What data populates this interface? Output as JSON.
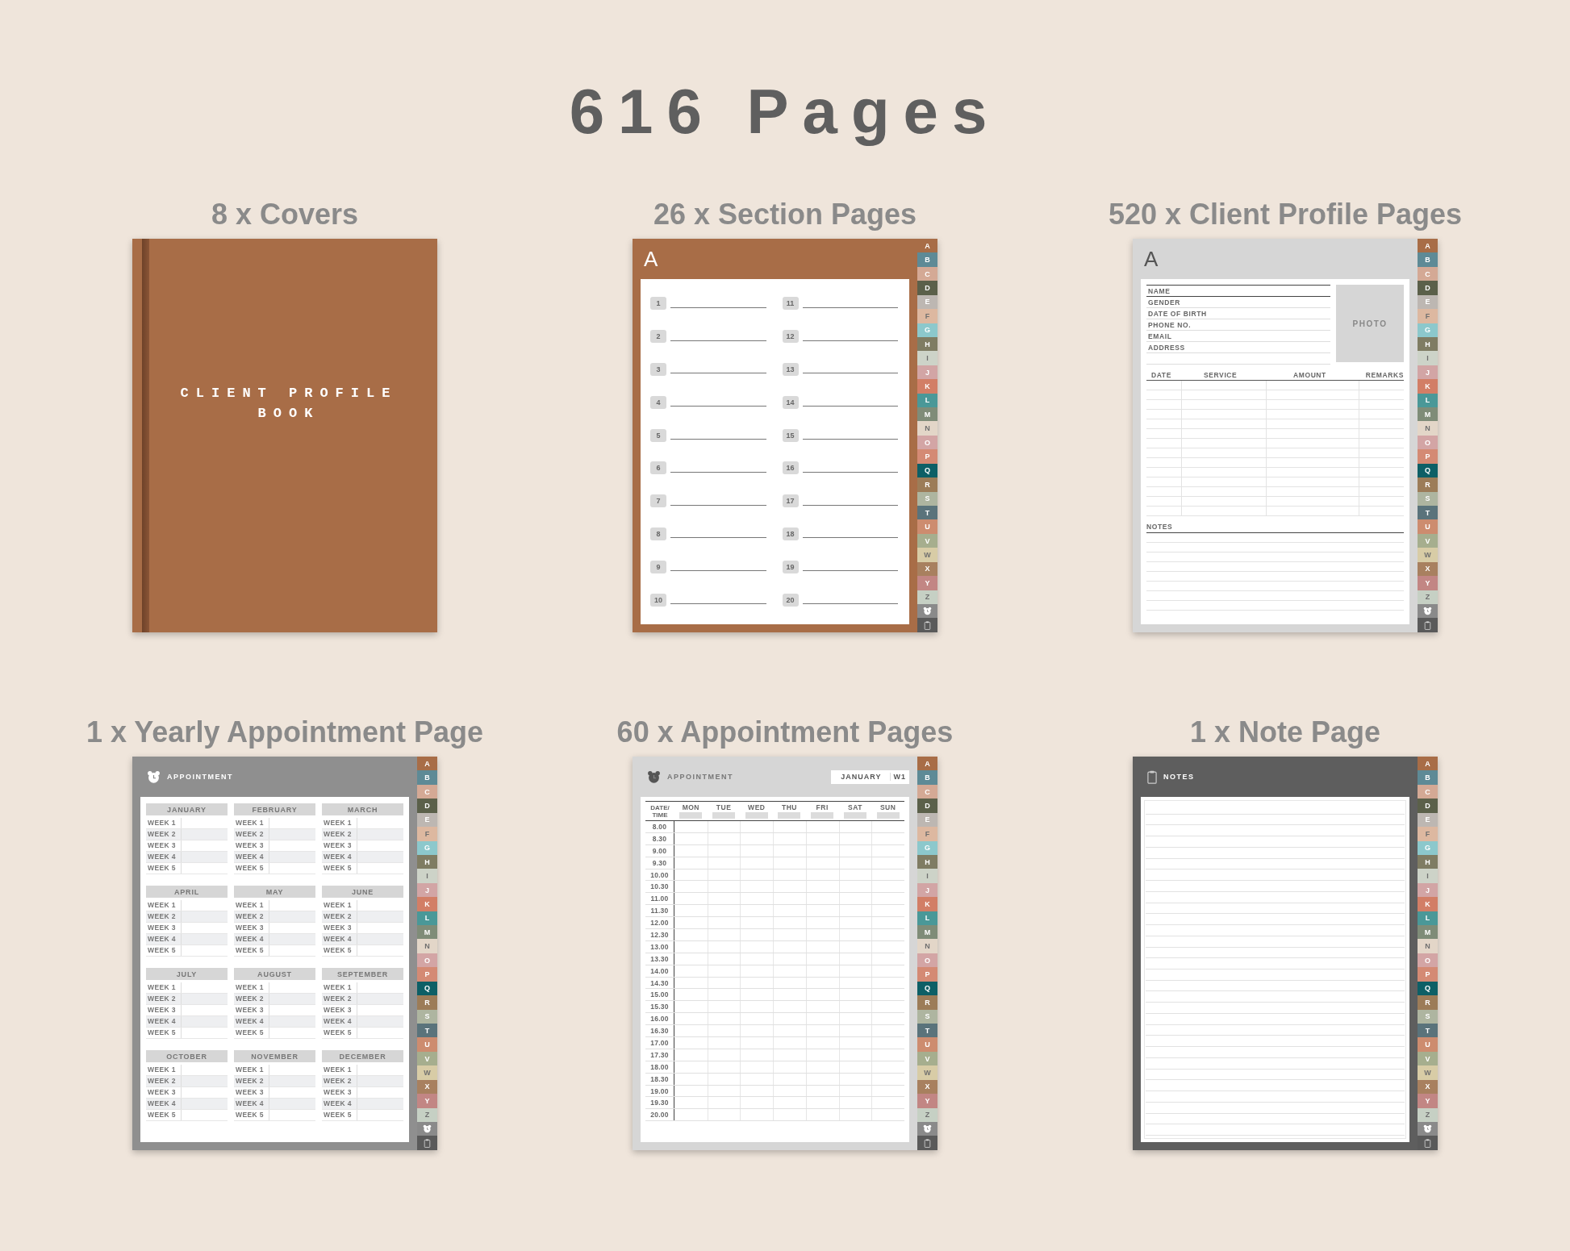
{
  "title": "616 Pages",
  "items": [
    {
      "kind": "cover",
      "caption": "8 x Covers",
      "page": {
        "title": "CLIENT PROFILE BOOK"
      }
    },
    {
      "kind": "section",
      "caption": "26 x Section Pages",
      "page": {
        "letter": "A",
        "numbers": [
          "1",
          "2",
          "3",
          "4",
          "5",
          "6",
          "7",
          "8",
          "9",
          "10",
          "11",
          "12",
          "13",
          "14",
          "15",
          "16",
          "17",
          "18",
          "19",
          "20"
        ],
        "tabs": [
          {
            "label": "A",
            "color": "#a86d47"
          },
          {
            "label": "B",
            "color": "#5e8a96"
          },
          {
            "label": "C",
            "color": "#d4a995"
          },
          {
            "label": "D",
            "color": "#5b604a"
          },
          {
            "label": "E",
            "color": "#bdb7b2"
          },
          {
            "label": "F",
            "color": "#ddb8a0"
          },
          {
            "label": "G",
            "color": "#8cc8cc"
          },
          {
            "label": "H",
            "color": "#7f7c63"
          },
          {
            "label": "I",
            "color": "#cdd3c8"
          },
          {
            "label": "J",
            "color": "#d2a5a5"
          },
          {
            "label": "K",
            "color": "#d27e66"
          },
          {
            "label": "L",
            "color": "#4a9898"
          },
          {
            "label": "M",
            "color": "#7f8c78"
          },
          {
            "label": "N",
            "color": "#e3d6c8"
          },
          {
            "label": "O",
            "color": "#d3a5a5"
          },
          {
            "label": "P",
            "color": "#d48a74"
          },
          {
            "label": "Q",
            "color": "#0d5f66"
          },
          {
            "label": "R",
            "color": "#9c7c58"
          },
          {
            "label": "S",
            "color": "#aeb5a0"
          },
          {
            "label": "T",
            "color": "#5a737b"
          },
          {
            "label": "U",
            "color": "#cd8c6f"
          },
          {
            "label": "V",
            "color": "#a6ae8e"
          },
          {
            "label": "W",
            "color": "#d8cca6"
          },
          {
            "label": "X",
            "color": "#a8805f"
          },
          {
            "label": "Y",
            "color": "#c28684"
          },
          {
            "label": "Z",
            "color": "#c6d0c4"
          }
        ]
      }
    },
    {
      "kind": "profile",
      "caption": "520 x Client Profile Pages",
      "page": {
        "letter": "A",
        "fields": [
          "NAME",
          "GENDER",
          "DATE OF BIRTH",
          "PHONE NO.",
          "EMAIL",
          "ADDRESS"
        ],
        "photo": "PHOTO",
        "columns": [
          "DATE",
          "SERVICE",
          "AMOUNT",
          "REMARKS"
        ],
        "notes": "NOTES",
        "tabs": [
          {
            "label": "A",
            "color": "#a86d47"
          },
          {
            "label": "B",
            "color": "#5e8a96"
          },
          {
            "label": "C",
            "color": "#d4a995"
          },
          {
            "label": "D",
            "color": "#5b604a"
          },
          {
            "label": "E",
            "color": "#bdb7b2"
          },
          {
            "label": "F",
            "color": "#ddb8a0"
          },
          {
            "label": "G",
            "color": "#8cc8cc"
          },
          {
            "label": "H",
            "color": "#7f7c63"
          },
          {
            "label": "I",
            "color": "#cdd3c8"
          },
          {
            "label": "J",
            "color": "#d2a5a5"
          },
          {
            "label": "K",
            "color": "#d27e66"
          },
          {
            "label": "L",
            "color": "#4a9898"
          },
          {
            "label": "M",
            "color": "#7f8c78"
          },
          {
            "label": "N",
            "color": "#e3d6c8"
          },
          {
            "label": "O",
            "color": "#d3a5a5"
          },
          {
            "label": "P",
            "color": "#d48a74"
          },
          {
            "label": "Q",
            "color": "#0d5f66"
          },
          {
            "label": "R",
            "color": "#9c7c58"
          },
          {
            "label": "S",
            "color": "#aeb5a0"
          },
          {
            "label": "T",
            "color": "#5a737b"
          },
          {
            "label": "U",
            "color": "#cd8c6f"
          },
          {
            "label": "V",
            "color": "#a6ae8e"
          },
          {
            "label": "W",
            "color": "#d8cca6"
          },
          {
            "label": "X",
            "color": "#a8805f"
          },
          {
            "label": "Y",
            "color": "#c28684"
          },
          {
            "label": "Z",
            "color": "#c6d0c4"
          }
        ]
      }
    },
    {
      "kind": "yearly",
      "caption": "1 x Yearly Appointment Page",
      "page": {
        "title": "APPOINTMENT",
        "months": [
          {
            "name": "JANUARY",
            "weeks": [
              "WEEK 1",
              "WEEK 2",
              "WEEK 3",
              "WEEK 4",
              "WEEK 5"
            ]
          },
          {
            "name": "FEBRUARY",
            "weeks": [
              "WEEK 1",
              "WEEK 2",
              "WEEK 3",
              "WEEK 4",
              "WEEK 5"
            ]
          },
          {
            "name": "MARCH",
            "weeks": [
              "WEEK 1",
              "WEEK 2",
              "WEEK 3",
              "WEEK 4",
              "WEEK 5"
            ]
          },
          {
            "name": "APRIL",
            "weeks": [
              "WEEK 1",
              "WEEK 2",
              "WEEK 3",
              "WEEK 4",
              "WEEK 5"
            ]
          },
          {
            "name": "MAY",
            "weeks": [
              "WEEK 1",
              "WEEK 2",
              "WEEK 3",
              "WEEK 4",
              "WEEK 5"
            ]
          },
          {
            "name": "JUNE",
            "weeks": [
              "WEEK 1",
              "WEEK 2",
              "WEEK 3",
              "WEEK 4",
              "WEEK 5"
            ]
          },
          {
            "name": "JULY",
            "weeks": [
              "WEEK 1",
              "WEEK 2",
              "WEEK 3",
              "WEEK 4",
              "WEEK 5"
            ]
          },
          {
            "name": "AUGUST",
            "weeks": [
              "WEEK 1",
              "WEEK 2",
              "WEEK 3",
              "WEEK 4",
              "WEEK 5"
            ]
          },
          {
            "name": "SEPTEMBER",
            "weeks": [
              "WEEK 1",
              "WEEK 2",
              "WEEK 3",
              "WEEK 4",
              "WEEK 5"
            ]
          },
          {
            "name": "OCTOBER",
            "weeks": [
              "WEEK 1",
              "WEEK 2",
              "WEEK 3",
              "WEEK 4",
              "WEEK 5"
            ]
          },
          {
            "name": "NOVEMBER",
            "weeks": [
              "WEEK 1",
              "WEEK 2",
              "WEEK 3",
              "WEEK 4",
              "WEEK 5"
            ]
          },
          {
            "name": "DECEMBER",
            "weeks": [
              "WEEK 1",
              "WEEK 2",
              "WEEK 3",
              "WEEK 4",
              "WEEK 5"
            ]
          }
        ],
        "tabs": [
          {
            "label": "A",
            "color": "#a86d47"
          },
          {
            "label": "B",
            "color": "#5e8a96"
          },
          {
            "label": "C",
            "color": "#d4a995"
          },
          {
            "label": "D",
            "color": "#5b604a"
          },
          {
            "label": "E",
            "color": "#bdb7b2"
          },
          {
            "label": "F",
            "color": "#ddb8a0"
          },
          {
            "label": "G",
            "color": "#8cc8cc"
          },
          {
            "label": "H",
            "color": "#7f7c63"
          },
          {
            "label": "I",
            "color": "#cdd3c8"
          },
          {
            "label": "J",
            "color": "#d2a5a5"
          },
          {
            "label": "K",
            "color": "#d27e66"
          },
          {
            "label": "L",
            "color": "#4a9898"
          },
          {
            "label": "M",
            "color": "#7f8c78"
          },
          {
            "label": "N",
            "color": "#e3d6c8"
          },
          {
            "label": "O",
            "color": "#d3a5a5"
          },
          {
            "label": "P",
            "color": "#d48a74"
          },
          {
            "label": "Q",
            "color": "#0d5f66"
          },
          {
            "label": "R",
            "color": "#9c7c58"
          },
          {
            "label": "S",
            "color": "#aeb5a0"
          },
          {
            "label": "T",
            "color": "#5a737b"
          },
          {
            "label": "U",
            "color": "#cd8c6f"
          },
          {
            "label": "V",
            "color": "#a6ae8e"
          },
          {
            "label": "W",
            "color": "#d8cca6"
          },
          {
            "label": "X",
            "color": "#a8805f"
          },
          {
            "label": "Y",
            "color": "#c28684"
          },
          {
            "label": "Z",
            "color": "#c6d0c4"
          }
        ]
      }
    },
    {
      "kind": "weekly",
      "caption": "60 x Appointment Pages",
      "page": {
        "title": "APPOINTMENT",
        "month": "JANUARY",
        "week": "W1",
        "corner": "DATE/ TIME",
        "days": [
          "MON",
          "TUE",
          "WED",
          "THU",
          "FRI",
          "SAT",
          "SUN"
        ],
        "times": [
          "8.00",
          "8.30",
          "9.00",
          "9.30",
          "10.00",
          "10.30",
          "11.00",
          "11.30",
          "12.00",
          "12.30",
          "13.00",
          "13.30",
          "14.00",
          "14.30",
          "15.00",
          "15.30",
          "16.00",
          "16.30",
          "17.00",
          "17.30",
          "18.00",
          "18.30",
          "19.00",
          "19.30",
          "20.00"
        ],
        "tabs": [
          {
            "label": "A",
            "color": "#a86d47"
          },
          {
            "label": "B",
            "color": "#5e8a96"
          },
          {
            "label": "C",
            "color": "#d4a995"
          },
          {
            "label": "D",
            "color": "#5b604a"
          },
          {
            "label": "E",
            "color": "#bdb7b2"
          },
          {
            "label": "F",
            "color": "#ddb8a0"
          },
          {
            "label": "G",
            "color": "#8cc8cc"
          },
          {
            "label": "H",
            "color": "#7f7c63"
          },
          {
            "label": "I",
            "color": "#cdd3c8"
          },
          {
            "label": "J",
            "color": "#d2a5a5"
          },
          {
            "label": "K",
            "color": "#d27e66"
          },
          {
            "label": "L",
            "color": "#4a9898"
          },
          {
            "label": "M",
            "color": "#7f8c78"
          },
          {
            "label": "N",
            "color": "#e3d6c8"
          },
          {
            "label": "O",
            "color": "#d3a5a5"
          },
          {
            "label": "P",
            "color": "#d48a74"
          },
          {
            "label": "Q",
            "color": "#0d5f66"
          },
          {
            "label": "R",
            "color": "#9c7c58"
          },
          {
            "label": "S",
            "color": "#aeb5a0"
          },
          {
            "label": "T",
            "color": "#5a737b"
          },
          {
            "label": "U",
            "color": "#cd8c6f"
          },
          {
            "label": "V",
            "color": "#a6ae8e"
          },
          {
            "label": "W",
            "color": "#d8cca6"
          },
          {
            "label": "X",
            "color": "#a8805f"
          },
          {
            "label": "Y",
            "color": "#c28684"
          },
          {
            "label": "Z",
            "color": "#c6d0c4"
          }
        ]
      }
    },
    {
      "kind": "notes",
      "caption": "1 x Note Page",
      "page": {
        "title": "NOTES",
        "tabs": [
          {
            "label": "A",
            "color": "#a86d47"
          },
          {
            "label": "B",
            "color": "#5e8a96"
          },
          {
            "label": "C",
            "color": "#d4a995"
          },
          {
            "label": "D",
            "color": "#5b604a"
          },
          {
            "label": "E",
            "color": "#bdb7b2"
          },
          {
            "label": "F",
            "color": "#ddb8a0"
          },
          {
            "label": "G",
            "color": "#8cc8cc"
          },
          {
            "label": "H",
            "color": "#7f7c63"
          },
          {
            "label": "I",
            "color": "#cdd3c8"
          },
          {
            "label": "J",
            "color": "#d2a5a5"
          },
          {
            "label": "K",
            "color": "#d27e66"
          },
          {
            "label": "L",
            "color": "#4a9898"
          },
          {
            "label": "M",
            "color": "#7f8c78"
          },
          {
            "label": "N",
            "color": "#e3d6c8"
          },
          {
            "label": "O",
            "color": "#d3a5a5"
          },
          {
            "label": "P",
            "color": "#d48a74"
          },
          {
            "label": "Q",
            "color": "#0d5f66"
          },
          {
            "label": "R",
            "color": "#9c7c58"
          },
          {
            "label": "S",
            "color": "#aeb5a0"
          },
          {
            "label": "T",
            "color": "#5a737b"
          },
          {
            "label": "U",
            "color": "#cd8c6f"
          },
          {
            "label": "V",
            "color": "#a6ae8e"
          },
          {
            "label": "W",
            "color": "#d8cca6"
          },
          {
            "label": "X",
            "color": "#a8805f"
          },
          {
            "label": "Y",
            "color": "#c28684"
          },
          {
            "label": "Z",
            "color": "#c6d0c4"
          }
        ]
      }
    }
  ]
}
